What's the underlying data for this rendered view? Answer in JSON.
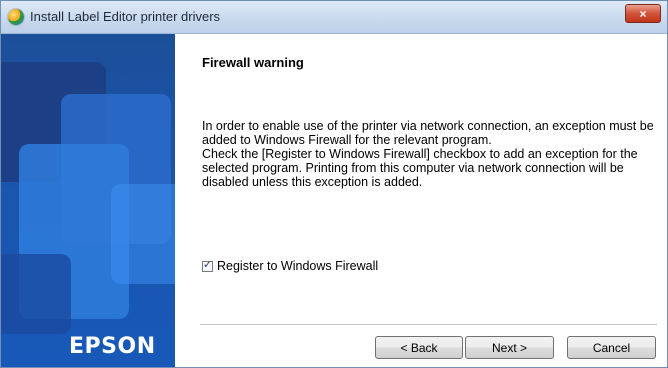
{
  "window": {
    "title": "Install Label Editor printer drivers",
    "close_label": "×"
  },
  "icons": {
    "app": "installer-globe-icon",
    "close": "close-icon",
    "check": "checkmark-icon"
  },
  "side_panel": {
    "brand": "EPSON"
  },
  "main": {
    "heading": "Firewall warning",
    "paragraph1": "In order to enable use of the printer via network connection, an exception must be added to Windows Firewall for the relevant program.",
    "paragraph2": "Check the [Register to Windows Firewall] checkbox to add an exception for the selected program. Printing from this computer via network connection will be disabled unless this exception is added.",
    "checkbox": {
      "label": "Register to Windows Firewall",
      "checked": true,
      "glyph": "✓"
    }
  },
  "buttons": {
    "back": "< Back",
    "next": "Next >",
    "cancel": "Cancel"
  },
  "colors": {
    "brand_blue": "#1a55ad",
    "close_red": "#c1341a"
  }
}
